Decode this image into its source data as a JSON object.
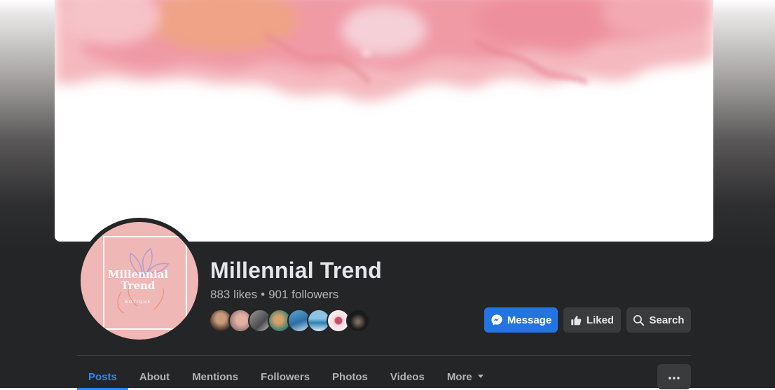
{
  "page": {
    "title": "Millennial Trend",
    "likes": "883 likes",
    "separator": "•",
    "followers": "901 followers"
  },
  "logo": {
    "line1": "Millennial",
    "line2": "Trend",
    "line3": "BOTIQUE"
  },
  "actions": {
    "message_label": "Message",
    "liked_label": "Liked",
    "search_label": "Search"
  },
  "tabs": [
    {
      "label": "Posts",
      "active": true
    },
    {
      "label": "About"
    },
    {
      "label": "Mentions"
    },
    {
      "label": "Followers"
    },
    {
      "label": "Photos"
    },
    {
      "label": "Videos"
    },
    {
      "label": "More"
    }
  ],
  "more_options_label": "···",
  "colors": {
    "background": "#242526",
    "primary_blue": "#2374e1",
    "active_tab_blue": "#2d88ff",
    "secondary_button": "#3a3b3c",
    "text_primary": "#e4e6eb",
    "text_secondary": "#b0b3b8",
    "logo_pink": "#efb7b5"
  },
  "icons": {
    "message": "messenger-icon",
    "liked": "thumbs-up-icon",
    "search": "search-icon",
    "more": "ellipsis-icon",
    "dropdown": "caret-down-icon"
  }
}
